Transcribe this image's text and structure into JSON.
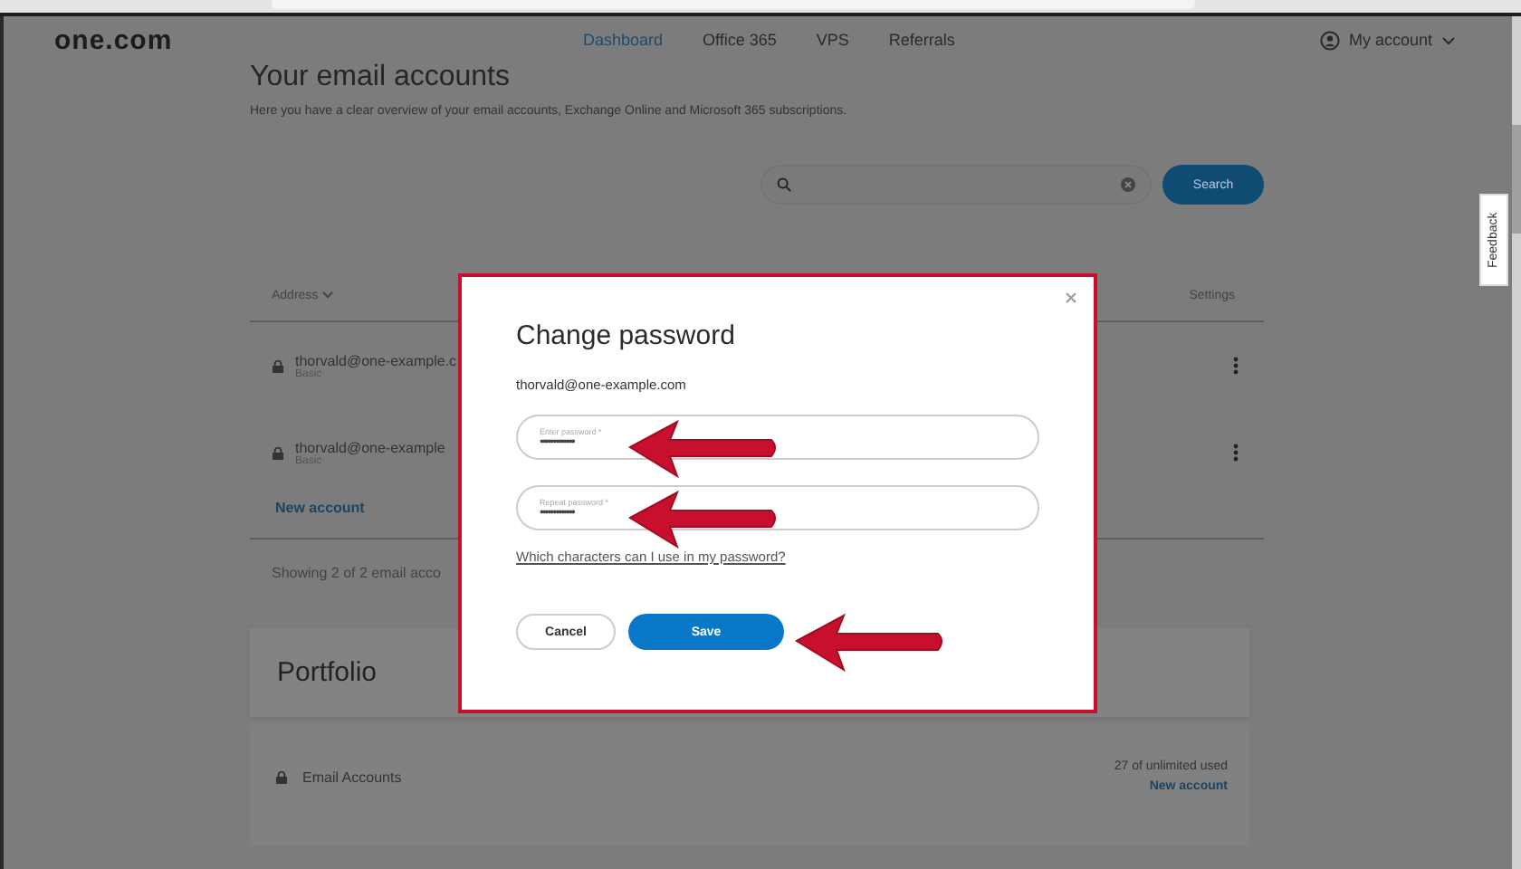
{
  "nav": {
    "logo": "one.com",
    "links": [
      {
        "label": "Dashboard",
        "selected": true
      },
      {
        "label": "Office 365",
        "selected": false
      },
      {
        "label": "VPS",
        "selected": false
      },
      {
        "label": "Referrals",
        "selected": false
      }
    ],
    "account": "My account"
  },
  "page": {
    "title": "Your email accounts",
    "subtitle": "Here you have a clear overview of your email accounts, Exchange Online and Microsoft 365 subscriptions.",
    "search_button": "Search",
    "table": {
      "columns": [
        "Address",
        "Settings"
      ],
      "rows": [
        {
          "address": "thorvald@one-example.c",
          "plan": "Basic"
        },
        {
          "address": "thorvald@one-example",
          "plan": "Basic"
        }
      ],
      "new_account": "New account",
      "footer": "Showing 2 of 2 email acco"
    }
  },
  "portfolio": {
    "title": "Portfolio",
    "rows": [
      {
        "label": "Email Accounts",
        "usage": "27 of unlimited used",
        "action": "New account"
      }
    ]
  },
  "dialog": {
    "title": "Change password",
    "email": "thorvald@one-example.com",
    "fields": [
      {
        "label": "Enter password *",
        "value": "•••••••••••••"
      },
      {
        "label": "Repeat password *",
        "value": "•••••••••••••"
      }
    ],
    "help_link": "Which characters can I use in my password?",
    "buttons": [
      {
        "label": "Cancel",
        "kind": "secondary"
      },
      {
        "label": "Save",
        "kind": "primary"
      }
    ]
  },
  "feedback": "Feedback"
}
